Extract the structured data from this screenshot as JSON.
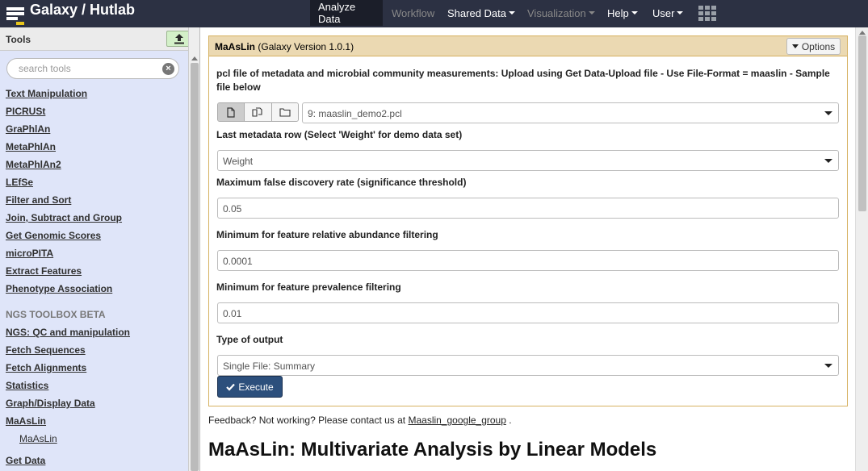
{
  "masthead": {
    "brand": "Galaxy / Hutlab",
    "nav": [
      {
        "label": "Analyze Data"
      },
      {
        "label": "Workflow"
      },
      {
        "label": "Shared Data"
      },
      {
        "label": "Visualization"
      },
      {
        "label": "Help"
      },
      {
        "label": "User"
      }
    ]
  },
  "tool_panel": {
    "title": "Tools",
    "search_placeholder": "search tools",
    "sections": [
      "Text Manipulation",
      "PICRUSt",
      "GraPhlAn",
      "MetaPhlAn",
      "MetaPhlAn2",
      "LEfSe",
      "Filter and Sort",
      "Join, Subtract and Group",
      "Get Genomic Scores",
      "microPITA",
      "Extract Features",
      "Phenotype Association"
    ],
    "label": "NGS TOOLBOX BETA",
    "sections2": [
      "NGS: QC and manipulation",
      "Fetch Sequences",
      "Fetch Alignments",
      "Statistics",
      "Graph/Display Data",
      "MaAsLin"
    ],
    "subtool": "MaAsLin",
    "sections3": [
      "Get Data"
    ]
  },
  "form": {
    "tool_name": "MaAsLin",
    "tool_version": "(Galaxy Version 1.0.1)",
    "options_label": "Options",
    "params": [
      {
        "label": "pcl file of metadata and microbial community measurements: Upload using Get Data-Upload file - Use File-Format = maaslin - Sample file below",
        "value": "9: maaslin_demo2.pcl"
      },
      {
        "label": "Last metadata row (Select 'Weight' for demo data set)",
        "value": "Weight"
      },
      {
        "label": "Maximum false discovery rate (significance threshold)",
        "value": "0.05"
      },
      {
        "label": "Minimum for feature relative abundance filtering",
        "value": "0.0001"
      },
      {
        "label": "Minimum for feature prevalence filtering",
        "value": "0.01"
      },
      {
        "label": "Type of output",
        "value": "Single File: Summary"
      }
    ],
    "execute_label": "Execute"
  },
  "feedback": {
    "text": "Feedback? Not working? Please contact us at",
    "link": "Maaslin_google_group",
    "suffix": "."
  },
  "help_title": "MaAsLin: Multivariate Analysis by Linear Models"
}
